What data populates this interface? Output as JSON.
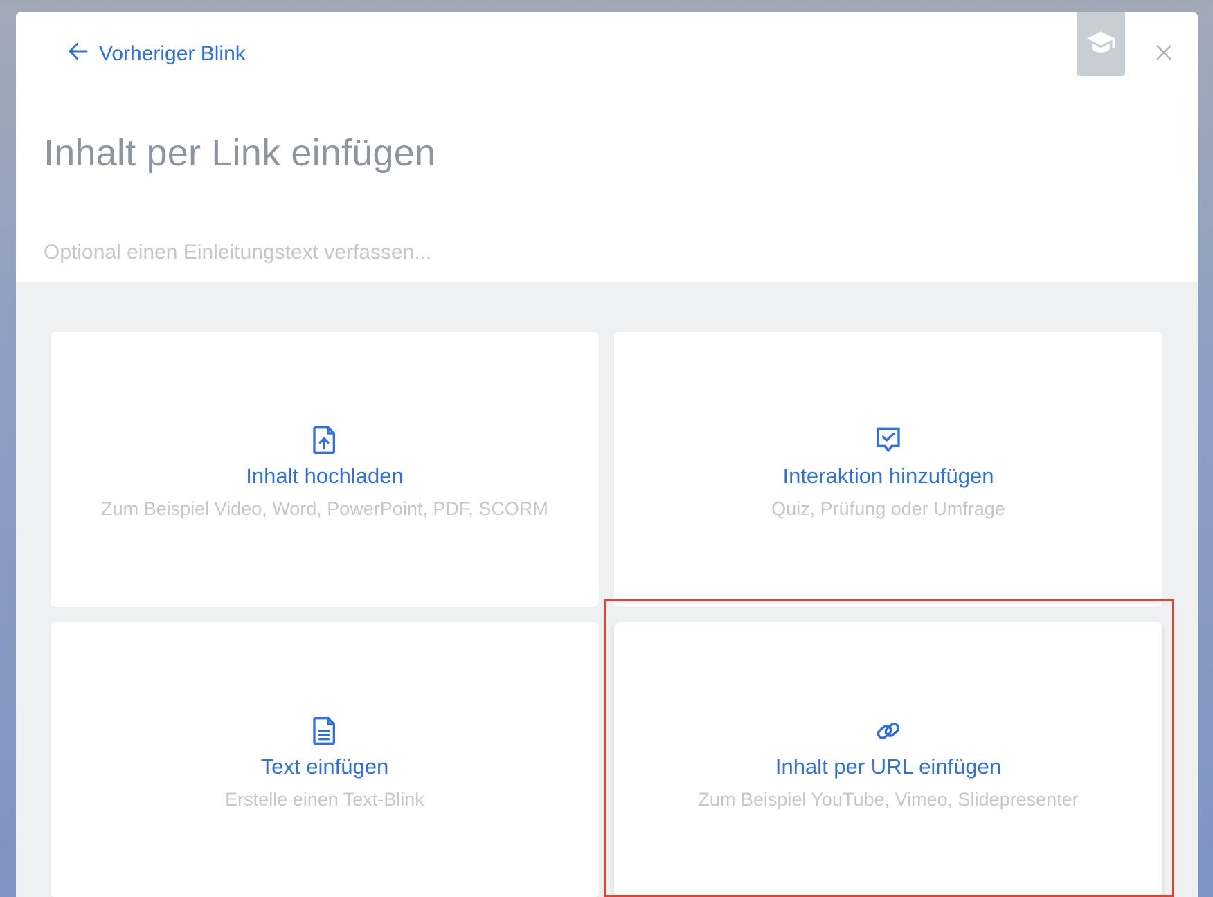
{
  "header": {
    "back_label": "Vorheriger Blink",
    "title": "Inhalt per Link einfügen",
    "intro_placeholder": "Optional einen Einleitungstext verfassen..."
  },
  "icons": {
    "back": "arrow-left-icon",
    "course": "graduation-cap-icon",
    "close": "close-icon"
  },
  "options": [
    {
      "title": "Inhalt hochladen",
      "desc": "Zum Beispiel Video, Word, PowerPoint, PDF, SCORM",
      "icon": "file-upload-icon"
    },
    {
      "title": "Interaktion hinzufügen",
      "desc": "Quiz, Prüfung oder Umfrage",
      "icon": "chat-check-icon"
    },
    {
      "title": "Text einfügen",
      "desc": "Erstelle einen Text-Blink",
      "icon": "file-text-icon"
    },
    {
      "title": "Inhalt per URL einfügen",
      "desc": "Zum Beispiel YouTube, Vimeo, Slidepresenter",
      "icon": "link-icon"
    }
  ],
  "colors": {
    "accent": "#2f6fe4",
    "highlight": "#e0432e",
    "muted_text": "#c4c8cd"
  }
}
